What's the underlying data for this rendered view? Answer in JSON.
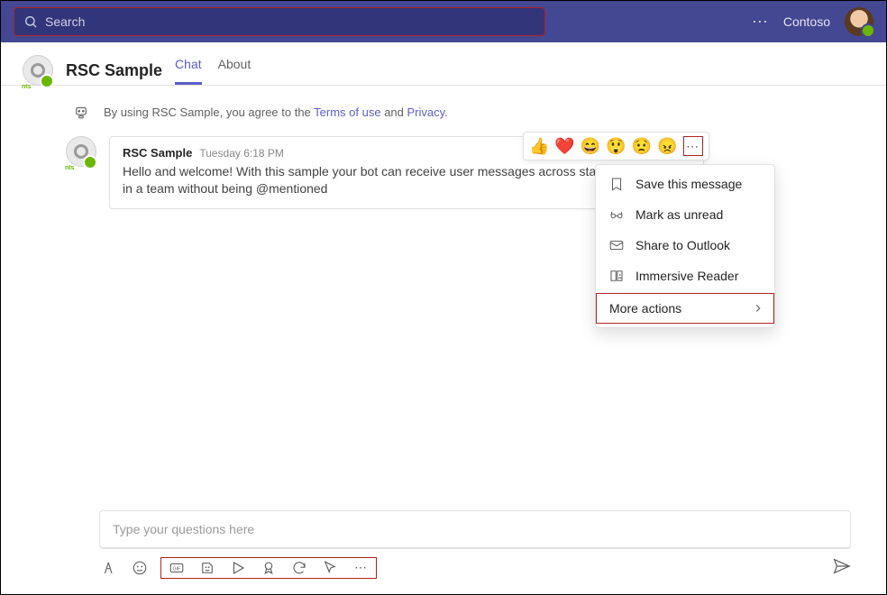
{
  "titlebar": {
    "search_placeholder": "Search",
    "org": "Contoso"
  },
  "header": {
    "title": "RSC Sample",
    "tabs": {
      "chat": "Chat",
      "about": "About"
    }
  },
  "notice": {
    "prefix": "By using RSC Sample, you agree to the ",
    "link_terms": "Terms of use",
    "mid": " and ",
    "link_privacy": "Privacy",
    "suffix": "."
  },
  "reactions": {
    "like": "👍",
    "heart": "❤️",
    "laugh": "😄",
    "surprised": "😲",
    "sad": "😟",
    "angry": "😠"
  },
  "message": {
    "author": "RSC Sample",
    "time": "Tuesday 6:18 PM",
    "body": "Hello and welcome! With this sample your bot can receive user messages across standard channels in a team without being @mentioned"
  },
  "ctxmenu": {
    "save": "Save this message",
    "unread": "Mark as unread",
    "share": "Share to Outlook",
    "reader": "Immersive Reader",
    "more": "More actions"
  },
  "compose": {
    "placeholder": "Type your questions here"
  }
}
